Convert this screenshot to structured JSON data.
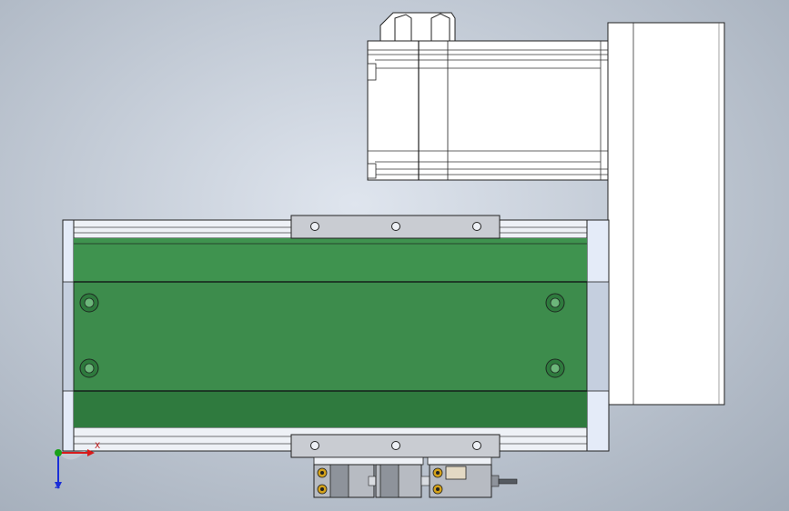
{
  "viewport": {
    "name": "cad-graphics-area",
    "background_top": "#dfe5ee",
    "background_bottom": "#a1abb8"
  },
  "model": {
    "body_color": "#3d8c4c",
    "body_shade": "#2e7a3d",
    "edge_color": "#1e2a22",
    "rail_color": "#eef1f6",
    "bracket_color": "#c9ccd2",
    "motor_color": "#ffffff",
    "screw_color": "#d4a21a"
  },
  "triad": {
    "x_label": "X",
    "y_label": "Y",
    "z_label": "Z",
    "x_color": "#d81a1a",
    "y_color": "#1aa01a",
    "z_color": "#1a2ed8"
  }
}
